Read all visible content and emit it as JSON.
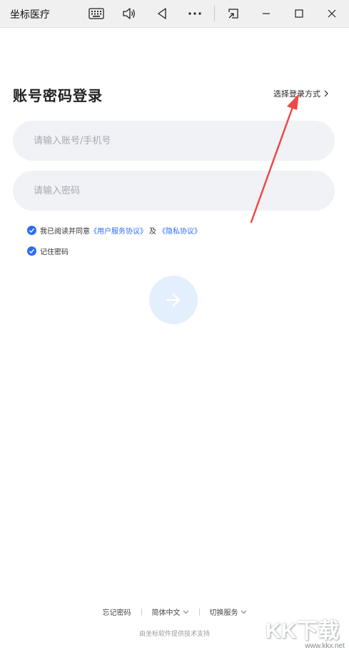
{
  "titlebar": {
    "app_title": "坐标医疗",
    "icons": [
      "keyboard-icon",
      "volume-icon",
      "back-icon",
      "more-icon",
      "window-resize-icon",
      "minimize-icon",
      "maximize-icon",
      "close-icon"
    ]
  },
  "login": {
    "title": "账号密码登录",
    "switch_method_label": "选择登录方式",
    "account_placeholder": "请输入账号/手机号",
    "password_placeholder": "请输入密码",
    "agree_prefix": "我已阅读并同意",
    "user_agreement": "《用户服务协议》",
    "and_text": "及",
    "privacy_agreement": "《隐私协议》",
    "remember_label": "记住密码",
    "agree_checked": true,
    "remember_checked": true
  },
  "footer": {
    "forgot_password": "忘记密码",
    "language": "简体中文",
    "switch_service": "切换服务",
    "powered_by": "由坐标软件提供技术支持"
  },
  "watermark": {
    "logo_text": "KK下载",
    "url": "www.kkx.net"
  },
  "colors": {
    "accent": "#2d6cf6",
    "submit_bg": "#e4effd",
    "field_bg": "#f1f2f6",
    "annotation_arrow": "#f04848"
  }
}
